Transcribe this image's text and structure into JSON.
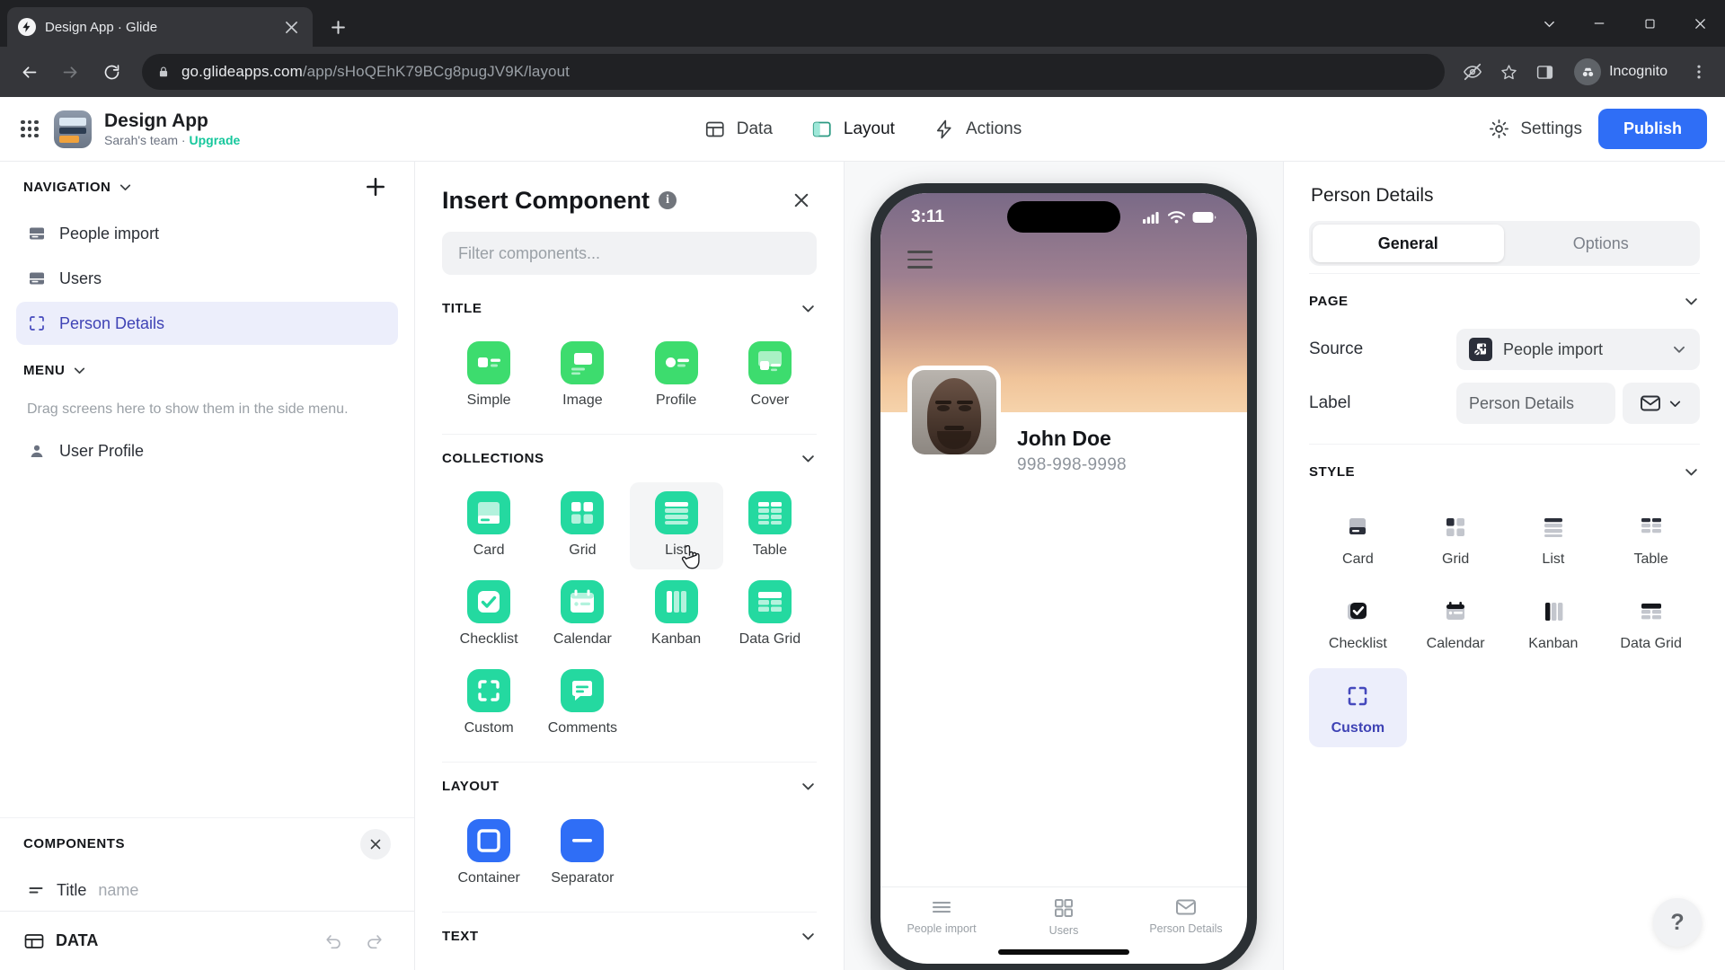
{
  "browser": {
    "tab": {
      "title": "Design App · Glide",
      "favicon": "glide-bolt-icon"
    },
    "url_host": "go.glideapps.com",
    "url_path": "/app/sHoQEhK79BCg8pugJV9K/layout",
    "profile_label": "Incognito"
  },
  "appbar": {
    "title": "Design App",
    "team": "Sarah's team · ",
    "upgrade": "Upgrade",
    "tabs": [
      {
        "label": "Data",
        "icon": "table-icon",
        "active": false
      },
      {
        "label": "Layout",
        "icon": "layout-icon",
        "active": true
      },
      {
        "label": "Actions",
        "icon": "bolt-icon",
        "active": false
      }
    ],
    "settings_label": "Settings",
    "publish_label": "Publish",
    "accent": "#2fd9b5",
    "publish_color": "#2f6ef6"
  },
  "sidebar": {
    "navigation_header": "NAVIGATION",
    "nav_items": [
      {
        "label": "People import",
        "icon": "table-source-icon",
        "selected": false
      },
      {
        "label": "Users",
        "icon": "table-source-icon",
        "selected": false
      },
      {
        "label": "Person Details",
        "icon": "custom-frame-icon",
        "selected": true
      }
    ],
    "menu_header": "MENU",
    "menu_hint": "Drag screens here to show them in the side menu.",
    "menu_items": [
      {
        "label": "User Profile",
        "icon": "person-icon"
      }
    ],
    "components_header": "COMPONENTS",
    "components": [
      {
        "name": "Title",
        "value": "name",
        "icon": "title-lines-icon"
      }
    ],
    "footer_data_label": "DATA"
  },
  "insert_panel": {
    "title": "Insert Component",
    "filter_placeholder": "Filter components...",
    "groups": [
      {
        "name": "TITLE",
        "accent": "#3ddc6e",
        "items": [
          {
            "label": "Simple",
            "icon": "title-simple-icon"
          },
          {
            "label": "Image",
            "icon": "title-image-icon"
          },
          {
            "label": "Profile",
            "icon": "title-profile-icon"
          },
          {
            "label": "Cover",
            "icon": "title-cover-icon"
          }
        ]
      },
      {
        "name": "COLLECTIONS",
        "accent": "#24d9a0",
        "items": [
          {
            "label": "Card",
            "icon": "card-icon",
            "hovered": false
          },
          {
            "label": "Grid",
            "icon": "grid-icon",
            "hovered": false
          },
          {
            "label": "List",
            "icon": "list-icon",
            "hovered": true
          },
          {
            "label": "Table",
            "icon": "table-icon",
            "hovered": false
          },
          {
            "label": "Checklist",
            "icon": "checklist-icon",
            "hovered": false
          },
          {
            "label": "Calendar",
            "icon": "calendar-icon",
            "hovered": false
          },
          {
            "label": "Kanban",
            "icon": "kanban-icon",
            "hovered": false
          },
          {
            "label": "Data Grid",
            "icon": "data-grid-icon",
            "hovered": false
          },
          {
            "label": "Custom",
            "icon": "custom-frame-icon",
            "hovered": false
          },
          {
            "label": "Comments",
            "icon": "comments-icon",
            "hovered": false
          }
        ]
      },
      {
        "name": "LAYOUT",
        "accent": "#2f6ef6",
        "items": [
          {
            "label": "Container",
            "icon": "container-icon"
          },
          {
            "label": "Separator",
            "icon": "separator-icon"
          }
        ]
      },
      {
        "name": "TEXT",
        "accent": "#2f6ef6",
        "items": []
      }
    ]
  },
  "preview": {
    "time": "3:11",
    "person_name": "John Doe",
    "person_phone": "998-998-9998",
    "tabs": [
      {
        "label": "People import",
        "icon": "list-lines-icon"
      },
      {
        "label": "Users",
        "icon": "grid-squares-icon"
      },
      {
        "label": "Person Details",
        "icon": "envelope-icon"
      }
    ]
  },
  "right_panel": {
    "title": "Person Details",
    "tabs": [
      {
        "label": "General",
        "active": true
      },
      {
        "label": "Options",
        "active": false
      }
    ],
    "page_section": "PAGE",
    "source_label": "Source",
    "source_value": "People import",
    "label_label": "Label",
    "label_value": "Person Details",
    "label_icon": "envelope-icon",
    "style_section": "STYLE",
    "styles": [
      {
        "label": "Card",
        "icon": "card-icon",
        "selected": false
      },
      {
        "label": "Grid",
        "icon": "grid-icon",
        "selected": false
      },
      {
        "label": "List",
        "icon": "list-icon",
        "selected": false
      },
      {
        "label": "Table",
        "icon": "table-icon",
        "selected": false
      },
      {
        "label": "Checklist",
        "icon": "checklist-icon",
        "selected": false
      },
      {
        "label": "Calendar",
        "icon": "calendar-icon",
        "selected": false
      },
      {
        "label": "Kanban",
        "icon": "kanban-icon",
        "selected": false
      },
      {
        "label": "Data Grid",
        "icon": "data-grid-icon",
        "selected": false
      },
      {
        "label": "Custom",
        "icon": "custom-frame-icon",
        "selected": true
      }
    ],
    "help_label": "?"
  }
}
